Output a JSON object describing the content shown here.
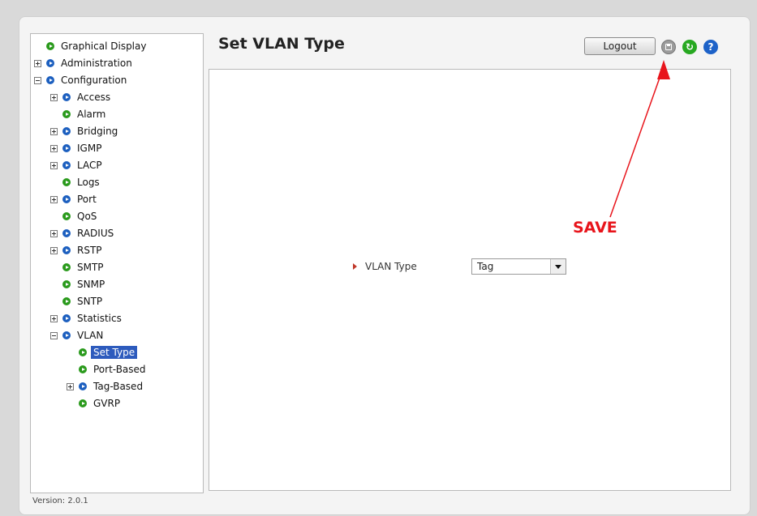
{
  "sidebar": {
    "items": [
      {
        "label": "Graphical Display",
        "level": 0,
        "expander": "none",
        "bullet": "green"
      },
      {
        "label": "Administration",
        "level": 0,
        "expander": "plus",
        "bullet": "blue"
      },
      {
        "label": "Configuration",
        "level": 0,
        "expander": "minus",
        "bullet": "blue"
      },
      {
        "label": "Access",
        "level": 1,
        "expander": "plus",
        "bullet": "blue"
      },
      {
        "label": "Alarm",
        "level": 1,
        "expander": "none",
        "bullet": "green"
      },
      {
        "label": "Bridging",
        "level": 1,
        "expander": "plus",
        "bullet": "blue"
      },
      {
        "label": "IGMP",
        "level": 1,
        "expander": "plus",
        "bullet": "blue"
      },
      {
        "label": "LACP",
        "level": 1,
        "expander": "plus",
        "bullet": "blue"
      },
      {
        "label": "Logs",
        "level": 1,
        "expander": "none",
        "bullet": "green"
      },
      {
        "label": "Port",
        "level": 1,
        "expander": "plus",
        "bullet": "blue"
      },
      {
        "label": "QoS",
        "level": 1,
        "expander": "none",
        "bullet": "green"
      },
      {
        "label": "RADIUS",
        "level": 1,
        "expander": "plus",
        "bullet": "blue"
      },
      {
        "label": "RSTP",
        "level": 1,
        "expander": "plus",
        "bullet": "blue"
      },
      {
        "label": "SMTP",
        "level": 1,
        "expander": "none",
        "bullet": "green"
      },
      {
        "label": "SNMP",
        "level": 1,
        "expander": "none",
        "bullet": "green"
      },
      {
        "label": "SNTP",
        "level": 1,
        "expander": "none",
        "bullet": "green"
      },
      {
        "label": "Statistics",
        "level": 1,
        "expander": "plus",
        "bullet": "blue"
      },
      {
        "label": "VLAN",
        "level": 1,
        "expander": "minus",
        "bullet": "blue"
      },
      {
        "label": "Set Type",
        "level": 2,
        "expander": "none",
        "bullet": "green",
        "selected": true
      },
      {
        "label": "Port-Based",
        "level": 2,
        "expander": "none",
        "bullet": "green"
      },
      {
        "label": "Tag-Based",
        "level": 2,
        "expander": "plus",
        "bullet": "blue"
      },
      {
        "label": "GVRP",
        "level": 2,
        "expander": "none",
        "bullet": "green"
      }
    ]
  },
  "version": "Version: 2.0.1",
  "header": {
    "title": "Set VLAN Type",
    "logout_label": "Logout",
    "icons": [
      "save-icon",
      "refresh-icon",
      "help-icon"
    ]
  },
  "form": {
    "vlan_type_label": "VLAN Type",
    "vlan_type_value": "Tag"
  },
  "annotation": {
    "text": "SAVE",
    "color": "#e8141b"
  },
  "colors": {
    "selected_bg": "#2d5bbd",
    "green_bullet": "#2a9a1c",
    "blue_bullet": "#1c5fbf"
  }
}
